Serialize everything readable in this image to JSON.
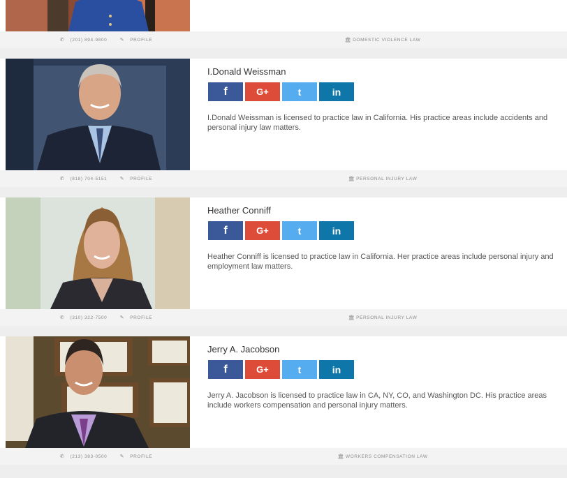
{
  "social": {
    "facebook": "f",
    "googleplus": "G+",
    "twitter": "t",
    "linkedin": "in"
  },
  "cards": [
    {
      "phone": "(201) 894-9800",
      "profile_label": "PROFILE",
      "practice_area": "DOMESTIC VIOLENCE LAW"
    },
    {
      "name": "I.Donald Weissman",
      "bio": "I.Donald Weissman is licensed to practice law in California. His practice areas include accidents and personal injury law matters.",
      "phone": "(818) 704-5151",
      "profile_label": "PROFILE",
      "practice_area": "PERSONAL INJURY LAW"
    },
    {
      "name": "Heather Conniff",
      "bio": "Heather Conniff is licensed to practice law in California. Her practice areas include personal injury and employment law matters.",
      "phone": "(310) 322-7500",
      "profile_label": "PROFILE",
      "practice_area": "PERSONAL INJURY LAW"
    },
    {
      "name": "Jerry A. Jacobson",
      "bio": "Jerry A. Jacobson is licensed to practice law in CA, NY, CO, and Washington DC. His practice areas include workers compensation and personal injury matters.",
      "phone": "(213) 383-0500",
      "profile_label": "PROFILE",
      "practice_area": "WORKERS COMPENSATION LAW"
    }
  ],
  "colors": {
    "facebook": "#3b5998",
    "googleplus": "#dd4b39",
    "twitter": "#55acee",
    "linkedin": "#0e76a8"
  },
  "icons": {
    "phone": "phone-icon",
    "profile": "pencil-icon",
    "practice": "courthouse-icon"
  }
}
